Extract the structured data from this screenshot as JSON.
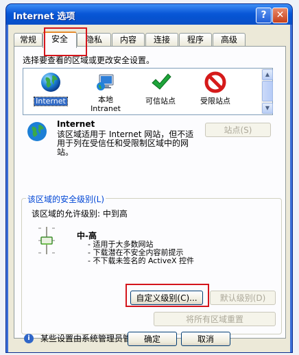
{
  "window": {
    "title": "Internet 选项",
    "help_glyph": "?",
    "close_glyph": "✕"
  },
  "tabs": [
    {
      "label": "常规"
    },
    {
      "label": "安全"
    },
    {
      "label": "隐私"
    },
    {
      "label": "内容"
    },
    {
      "label": "连接"
    },
    {
      "label": "程序"
    },
    {
      "label": "高级"
    }
  ],
  "security": {
    "instruction": "选择要查看的区域或更改安全设置。",
    "zones": [
      {
        "line1": "Internet",
        "line2": "",
        "icon": "globe-icon",
        "selected": true
      },
      {
        "line1": "本地",
        "line2": "Intranet",
        "icon": "intranet-icon",
        "selected": false
      },
      {
        "line1": "可信站点",
        "line2": "",
        "icon": "checkmark-icon",
        "selected": false
      },
      {
        "line1": "受限站点",
        "line2": "",
        "icon": "no-entry-icon",
        "selected": false
      }
    ],
    "sites_button": "站点(S)",
    "zone_name": "Internet",
    "zone_description": "该区域适用于 Internet 网站，但不适用于列在受信任和受限制区域中的网站。",
    "level_group_title": "该区域的安全级别(L)",
    "allowed_levels": "该区域的允许级别: 中到高",
    "level_name": "中-高",
    "level_items": [
      "- 适用于大多数网站",
      "- 下载潜在不安全内容前提示",
      "- 不下载未签名的 ActiveX 控件"
    ],
    "custom_level_button": "自定义级别(C)...",
    "default_level_button": "默认级别(D)",
    "reset_all_button": "将所有区域重置",
    "admin_note": "某些设置由系统管理员管理。"
  },
  "footer": {
    "ok_button": "确定",
    "cancel_button": "取消"
  }
}
